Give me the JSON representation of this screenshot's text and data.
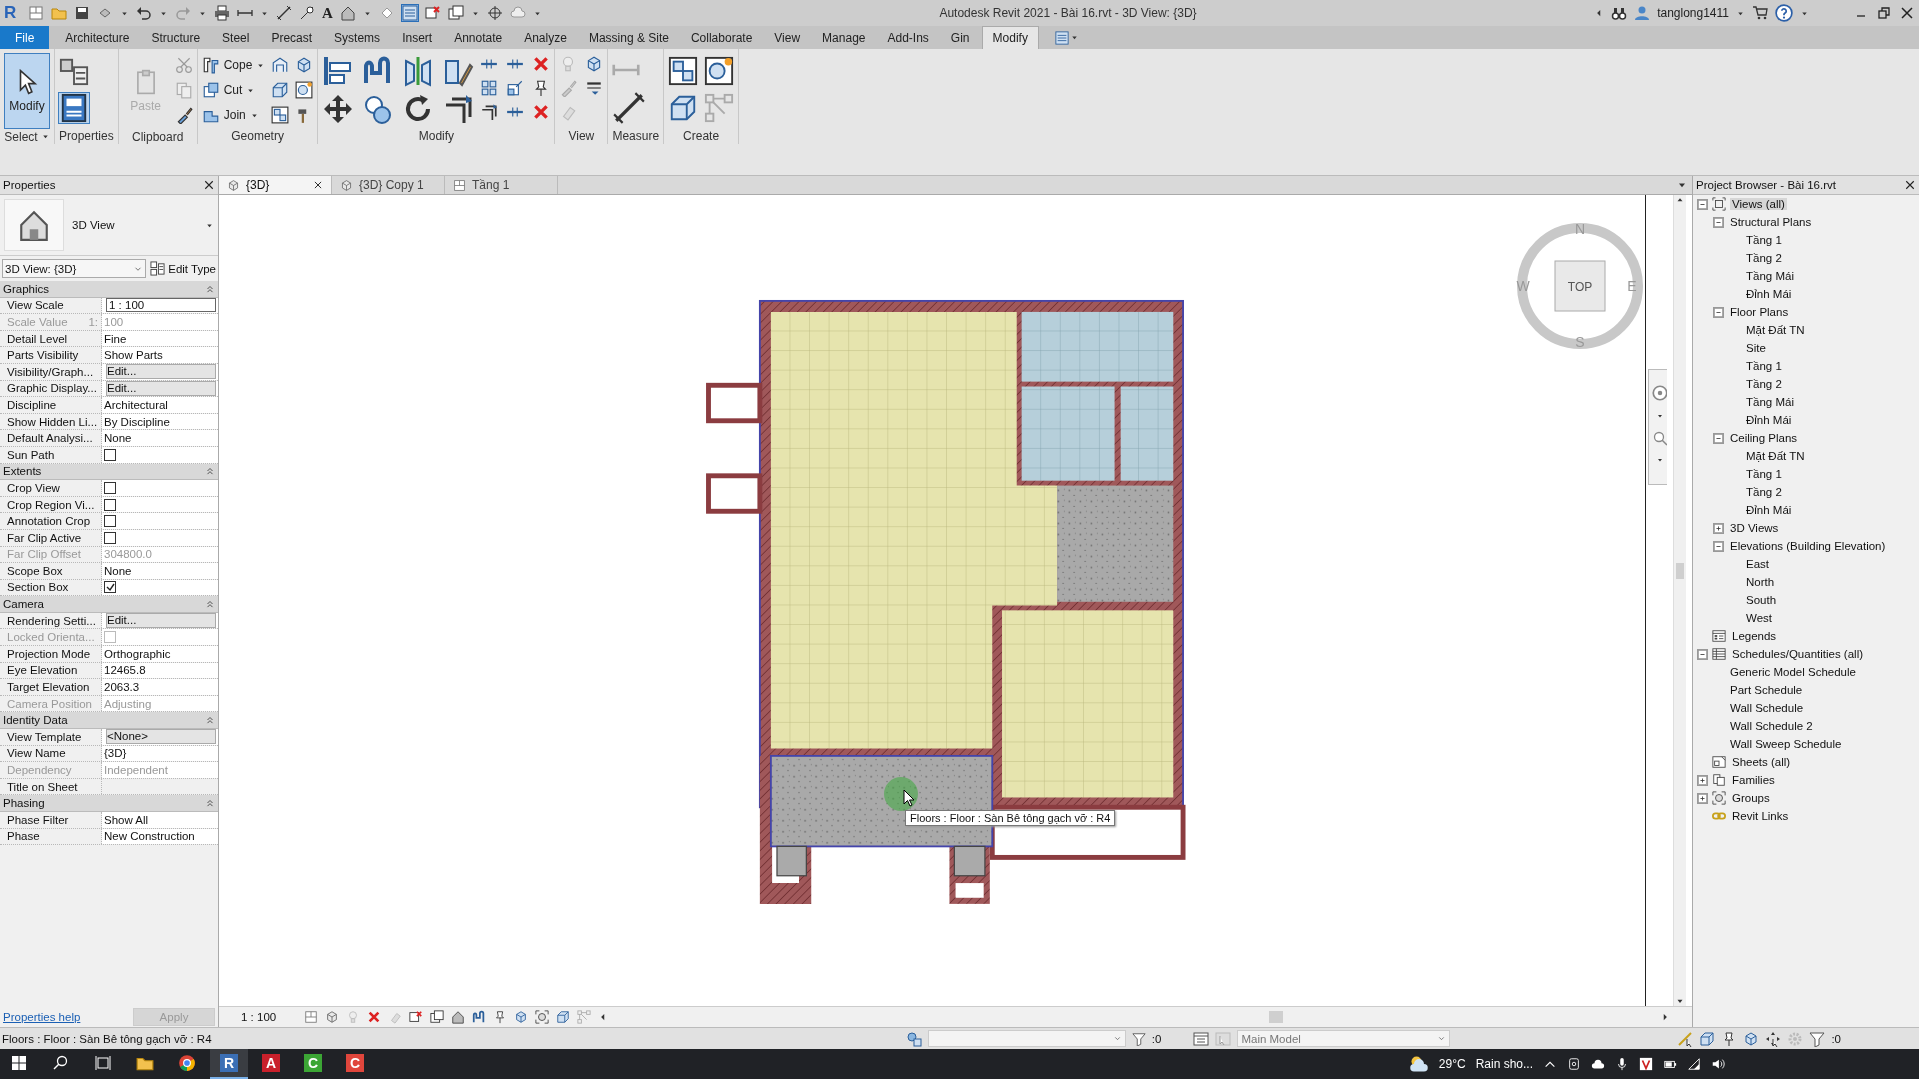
{
  "window": {
    "app_logo": "R",
    "text_tool": "A",
    "title": "Autodesk Revit 2021 - Bài 16.rvt - 3D View: {3D}",
    "user": "tanglong1411"
  },
  "menu_tabs": [
    {
      "label": "File",
      "kind": "file",
      "selected": false
    },
    {
      "label": "Architecture",
      "kind": "tab",
      "selected": false
    },
    {
      "label": "Structure",
      "kind": "tab",
      "selected": false
    },
    {
      "label": "Steel",
      "kind": "tab",
      "selected": false
    },
    {
      "label": "Precast",
      "kind": "tab",
      "selected": false
    },
    {
      "label": "Systems",
      "kind": "tab",
      "selected": false
    },
    {
      "label": "Insert",
      "kind": "tab",
      "selected": false
    },
    {
      "label": "Annotate",
      "kind": "tab",
      "selected": false
    },
    {
      "label": "Analyze",
      "kind": "tab",
      "selected": false
    },
    {
      "label": "Massing & Site",
      "kind": "tab",
      "selected": false
    },
    {
      "label": "Collaborate",
      "kind": "tab",
      "selected": false
    },
    {
      "label": "View",
      "kind": "tab",
      "selected": false
    },
    {
      "label": "Manage",
      "kind": "tab",
      "selected": false
    },
    {
      "label": "Add-Ins",
      "kind": "tab",
      "selected": false
    },
    {
      "label": "Gin",
      "kind": "tab",
      "selected": false
    },
    {
      "label": "Modify",
      "kind": "tab",
      "selected": true
    }
  ],
  "ribbon": {
    "panels": [
      {
        "kind": "select",
        "title": "Select",
        "tools": [
          {
            "label": "Modify",
            "selected": true
          }
        ]
      },
      {
        "kind": "properties",
        "title": "Properties"
      },
      {
        "kind": "clipboard",
        "title": "Clipboard",
        "tools": [
          {
            "label": "Paste",
            "disabled": true
          }
        ]
      },
      {
        "kind": "geometry",
        "title": "Geometry",
        "tools": [
          {
            "label": "Cope"
          },
          {
            "label": "Cut"
          },
          {
            "label": "Join"
          }
        ]
      },
      {
        "kind": "modify",
        "title": "Modify"
      },
      {
        "kind": "view",
        "title": "View"
      },
      {
        "kind": "measure",
        "title": "Measure"
      },
      {
        "kind": "create",
        "title": "Create"
      }
    ]
  },
  "properties": {
    "title": "Properties",
    "type_name": "3D View",
    "selector": "3D View: {3D}",
    "edit_type": "Edit Type",
    "groups": [
      {
        "title": "Graphics",
        "rows": [
          {
            "label": "View Scale",
            "kind": "input",
            "value": "1 : 100",
            "disabled": false
          },
          {
            "label": "Scale Value",
            "unit": "1:",
            "kind": "text",
            "value": "100",
            "disabled": true
          },
          {
            "label": "Detail Level",
            "kind": "text",
            "value": "Fine",
            "disabled": false
          },
          {
            "label": "Parts Visibility",
            "kind": "text",
            "value": "Show Parts",
            "disabled": false
          },
          {
            "label": "Visibility/Graph...",
            "kind": "button",
            "value": "Edit...",
            "disabled": false
          },
          {
            "label": "Graphic Display...",
            "kind": "button",
            "value": "Edit...",
            "disabled": false
          },
          {
            "label": "Discipline",
            "kind": "text",
            "value": "Architectural",
            "disabled": false
          },
          {
            "label": "Show Hidden Li...",
            "kind": "text",
            "value": "By Discipline",
            "disabled": false
          },
          {
            "label": "Default Analysi...",
            "kind": "text",
            "value": "None",
            "disabled": false
          },
          {
            "label": "Sun Path",
            "kind": "checkbox",
            "checked": false,
            "disabled": false
          }
        ]
      },
      {
        "title": "Extents",
        "rows": [
          {
            "label": "Crop View",
            "kind": "checkbox",
            "checked": false,
            "disabled": false
          },
          {
            "label": "Crop Region Vi...",
            "kind": "checkbox",
            "checked": false,
            "disabled": false
          },
          {
            "label": "Annotation Crop",
            "kind": "checkbox",
            "checked": false,
            "disabled": false
          },
          {
            "label": "Far Clip Active",
            "kind": "checkbox",
            "checked": false,
            "disabled": false
          },
          {
            "label": "Far Clip Offset",
            "kind": "text",
            "value": "304800.0",
            "disabled": true
          },
          {
            "label": "Scope Box",
            "kind": "text",
            "value": "None",
            "disabled": false
          },
          {
            "label": "Section Box",
            "kind": "checkbox",
            "checked": true,
            "disabled": false
          }
        ]
      },
      {
        "title": "Camera",
        "rows": [
          {
            "label": "Rendering Setti...",
            "kind": "button",
            "value": "Edit...",
            "disabled": false
          },
          {
            "label": "Locked Orienta...",
            "kind": "checkbox",
            "checked": false,
            "disabled": true
          },
          {
            "label": "Projection Mode",
            "kind": "text",
            "value": "Orthographic",
            "disabled": false
          },
          {
            "label": "Eye Elevation",
            "kind": "text",
            "value": "12465.8",
            "disabled": false
          },
          {
            "label": "Target Elevation",
            "kind": "text",
            "value": "2063.3",
            "disabled": false
          },
          {
            "label": "Camera Position",
            "kind": "text",
            "value": "Adjusting",
            "disabled": true
          }
        ]
      },
      {
        "title": "Identity Data",
        "rows": [
          {
            "label": "View Template",
            "kind": "button",
            "value": "<None>",
            "disabled": false
          },
          {
            "label": "View Name",
            "kind": "text",
            "value": "{3D}",
            "disabled": false
          },
          {
            "label": "Dependency",
            "kind": "text",
            "value": "Independent",
            "disabled": true
          },
          {
            "label": "Title on Sheet",
            "kind": "text",
            "disabled": false
          }
        ]
      },
      {
        "title": "Phasing",
        "rows": [
          {
            "label": "Phase Filter",
            "kind": "text",
            "value": "Show All",
            "disabled": false
          },
          {
            "label": "Phase",
            "kind": "text",
            "value": "New Construction",
            "disabled": false
          }
        ]
      }
    ],
    "help_link": "Properties help",
    "apply": "Apply"
  },
  "view_tabs": [
    {
      "label": "{3D}",
      "selected": true
    },
    {
      "label": "{3D} Copy 1",
      "selected": false
    },
    {
      "label": "Tầng 1",
      "selected": false
    }
  ],
  "view_cube": {
    "top": "TOP",
    "north": "N",
    "south": "S",
    "east": "E",
    "west": "W"
  },
  "tooltip": "Floors : Floor : Sàn Bê tông gạch vỡ : R4",
  "view_control": {
    "scale": "1 : 100"
  },
  "browser": {
    "title": "Project Browser - Bài 16.rvt",
    "tree": [
      {
        "label": "Views (all)",
        "kind": "views",
        "expanded": true,
        "selected": true,
        "children": [
          {
            "label": "Structural Plans",
            "expanded": true,
            "selected": false,
            "children": [
              {
                "label": "Tầng 1",
                "selected": false
              },
              {
                "label": "Tầng 2",
                "selected": false
              },
              {
                "label": "Tầng Mái",
                "selected": false
              },
              {
                "label": "Đỉnh Mái",
                "selected": false
              }
            ]
          },
          {
            "label": "Floor Plans",
            "expanded": true,
            "selected": false,
            "children": [
              {
                "label": "Mặt Đất TN",
                "selected": false
              },
              {
                "label": "Site",
                "selected": false
              },
              {
                "label": "Tầng 1",
                "selected": false
              },
              {
                "label": "Tầng 2",
                "selected": false
              },
              {
                "label": "Tầng Mái",
                "selected": false
              },
              {
                "label": "Đỉnh Mái",
                "selected": false
              }
            ]
          },
          {
            "label": "Ceiling Plans",
            "expanded": true,
            "selected": false,
            "children": [
              {
                "label": "Mặt Đất TN",
                "selected": false
              },
              {
                "label": "Tầng 1",
                "selected": false
              },
              {
                "label": "Tầng 2",
                "selected": false
              },
              {
                "label": "Đỉnh Mái",
                "selected": false
              }
            ]
          },
          {
            "label": "3D Views",
            "expanded": false,
            "selected": false
          },
          {
            "label": "Elevations (Building Elevation)",
            "expanded": true,
            "selected": false,
            "children": [
              {
                "label": "East",
                "selected": false
              },
              {
                "label": "North",
                "selected": false
              },
              {
                "label": "South",
                "selected": false
              },
              {
                "label": "West",
                "selected": false
              }
            ]
          }
        ]
      },
      {
        "label": "Legends",
        "kind": "legend",
        "selected": false
      },
      {
        "label": "Schedules/Quantities (all)",
        "kind": "schedule",
        "expanded": true,
        "selected": false,
        "children": [
          {
            "label": "Generic Model Schedule",
            "selected": false
          },
          {
            "label": "Part Schedule",
            "selected": false
          },
          {
            "label": "Wall Schedule",
            "selected": false
          },
          {
            "label": "Wall Schedule 2",
            "selected": false
          },
          {
            "label": "Wall Sweep Schedule",
            "selected": false
          }
        ]
      },
      {
        "label": "Sheets (all)",
        "kind": "sheet",
        "selected": false
      },
      {
        "label": "Families",
        "kind": "family",
        "expanded": false,
        "selected": false
      },
      {
        "label": "Groups",
        "kind": "group",
        "expanded": false,
        "selected": false
      },
      {
        "label": "Revit Links",
        "kind": "link",
        "selected": false
      }
    ]
  },
  "status_bar": {
    "message": "Floors : Floor : Sàn Bê tông gạch vỡ : R4",
    "selection_count": ":0",
    "model": "Main Model",
    "filter_count": ":0"
  },
  "taskbar": {
    "apps": [
      {
        "kind": "folder",
        "selected": false
      },
      {
        "kind": "browser",
        "selected": false
      },
      {
        "kind": "letter",
        "glyph": "R",
        "color": "#3b6fb5",
        "selected": true
      },
      {
        "kind": "letter",
        "glyph": "A",
        "color": "#c9202b",
        "selected": false
      },
      {
        "kind": "letter",
        "glyph": "C",
        "color": "#3ca635",
        "selected": false
      },
      {
        "kind": "letter",
        "glyph": "C",
        "color": "#e0463c",
        "selected": false
      }
    ],
    "temperature": "29°C",
    "weather": "Rain sho..."
  }
}
